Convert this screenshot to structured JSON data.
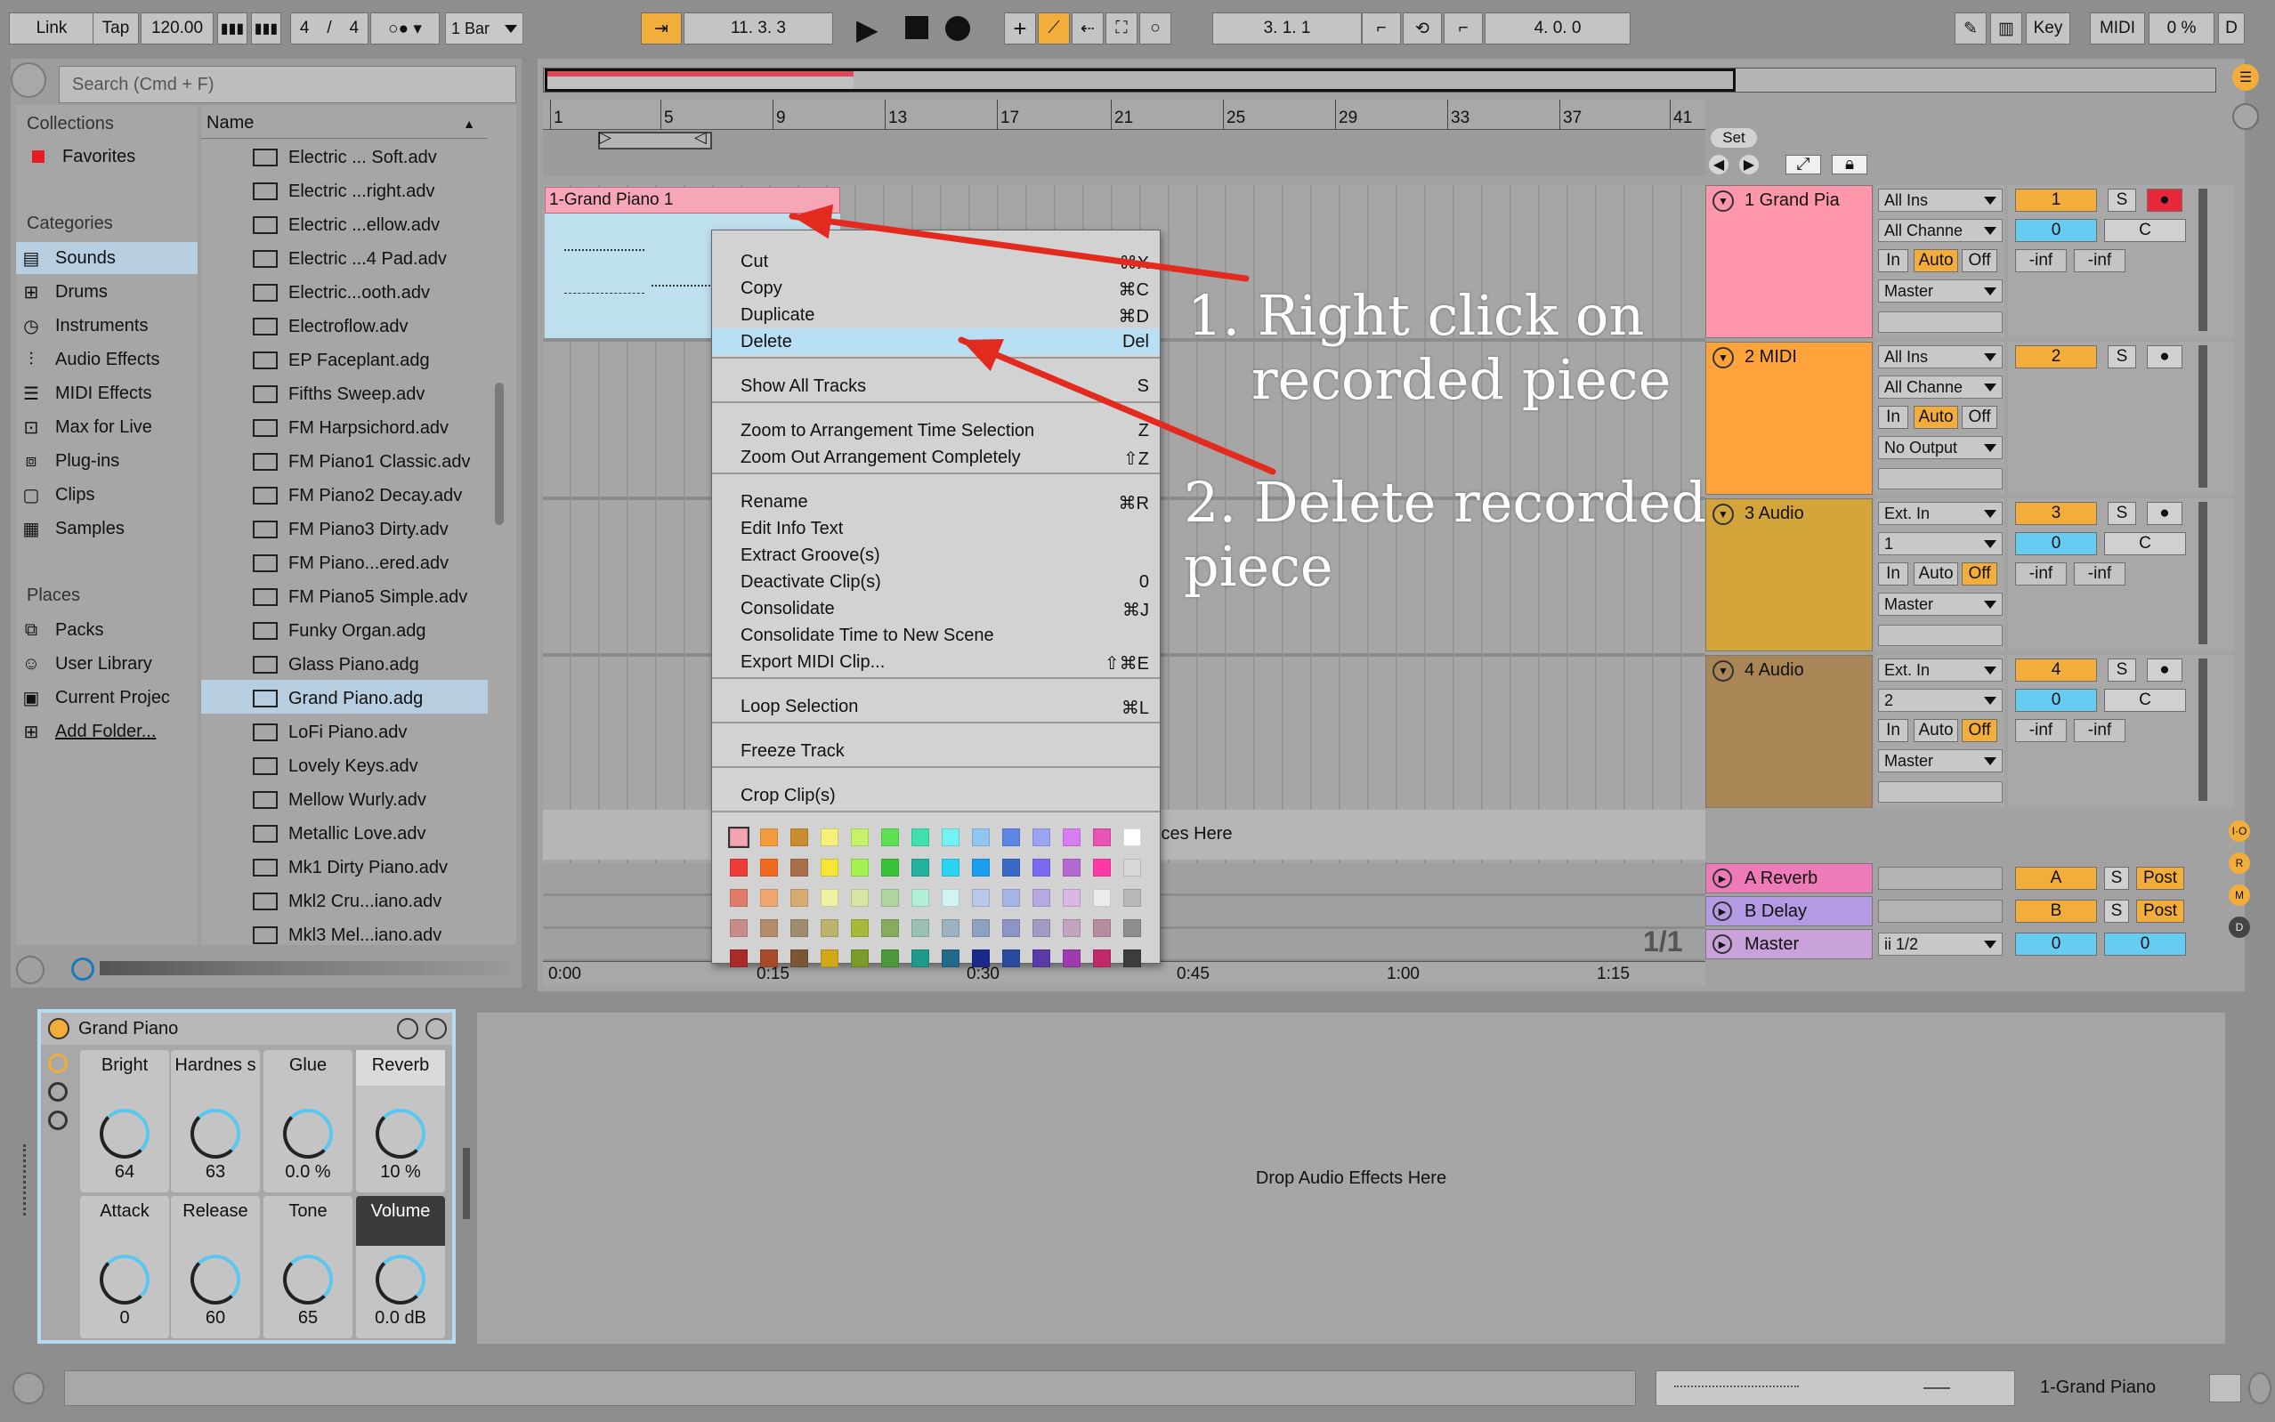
{
  "transport": {
    "link": "Link",
    "tap": "Tap",
    "tempo": "120.00",
    "sig_num": "4",
    "sig_slash": "/",
    "sig_den": "4",
    "quant": "1 Bar",
    "position": "11.  3.  3",
    "loop_start": "3.  1.  1",
    "loop_len": "4.  0.  0",
    "key": "Key",
    "midi": "MIDI",
    "cpu": "0 %",
    "d": "D"
  },
  "browser": {
    "search_placeholder": "Search (Cmd + F)",
    "collections_header": "Collections",
    "favorites": "Favorites",
    "categories_header": "Categories",
    "categories": [
      "Sounds",
      "Drums",
      "Instruments",
      "Audio Effects",
      "MIDI Effects",
      "Max for Live",
      "Plug-ins",
      "Clips",
      "Samples"
    ],
    "places_header": "Places",
    "places": [
      "Packs",
      "User Library",
      "Current Projec",
      "Add Folder..."
    ],
    "name_col": "Name",
    "files": [
      "Electric ... Soft.adv",
      "Electric ...right.adv",
      "Electric ...ellow.adv",
      "Electric ...4 Pad.adv",
      "Electric...ooth.adv",
      "Electroflow.adv",
      "EP Faceplant.adg",
      "Fifths Sweep.adv",
      "FM Harpsichord.adv",
      "FM Piano1 Classic.adv",
      "FM Piano2 Decay.adv",
      "FM Piano3 Dirty.adv",
      "FM Piano...ered.adv",
      "FM Piano5 Simple.adv",
      "Funky Organ.adg",
      "Glass Piano.adg",
      "Grand Piano.adg",
      "LoFi Piano.adv",
      "Lovely Keys.adv",
      "Mellow Wurly.adv",
      "Metallic Love.adv",
      "Mk1 Dirty Piano.adv",
      "Mkl2 Cru...iano.adv",
      "Mkl3 Mel...iano.adv"
    ]
  },
  "arrangement": {
    "ruler_bars": [
      "1",
      "5",
      "9",
      "13",
      "17",
      "21",
      "25",
      "29",
      "33",
      "37",
      "41"
    ],
    "time_marks": [
      "0:00",
      "0:15",
      "0:30",
      "0:45",
      "1:00",
      "1:15"
    ],
    "clip_name": "1-Grand Piano 1",
    "drop_hint": "ices Here",
    "page": "1/1",
    "set_label": "Set"
  },
  "context_menu": {
    "items": [
      {
        "label": "Cut",
        "shortcut": "⌘X"
      },
      {
        "label": "Copy",
        "shortcut": "⌘C"
      },
      {
        "label": "Duplicate",
        "shortcut": "⌘D"
      },
      {
        "label": "Delete",
        "shortcut": "Del"
      },
      {
        "label": "Show All Tracks",
        "shortcut": "S"
      },
      {
        "label": "Zoom to Arrangement Time Selection",
        "shortcut": "Z"
      },
      {
        "label": "Zoom Out Arrangement Completely",
        "shortcut": "⇧Z"
      },
      {
        "label": "Rename",
        "shortcut": "⌘R"
      },
      {
        "label": "Edit Info Text",
        "shortcut": ""
      },
      {
        "label": "Extract Groove(s)",
        "shortcut": ""
      },
      {
        "label": "Deactivate Clip(s)",
        "shortcut": "0"
      },
      {
        "label": "Consolidate",
        "shortcut": "⌘J"
      },
      {
        "label": "Consolidate Time to New Scene",
        "shortcut": ""
      },
      {
        "label": "Export MIDI Clip...",
        "shortcut": "⇧⌘E"
      },
      {
        "label": "Loop Selection",
        "shortcut": "⌘L"
      },
      {
        "label": "Freeze Track",
        "shortcut": ""
      },
      {
        "label": "Crop Clip(s)",
        "shortcut": ""
      }
    ],
    "swatches": [
      [
        "#f4a3b0",
        "#f39a3a",
        "#c98c2e",
        "#f4f07a",
        "#c6f26a",
        "#5de052",
        "#40e0b0",
        "#72f2f2",
        "#90c6f2",
        "#5c86e6",
        "#9aa4f2",
        "#d67ef2",
        "#e853b5",
        "#ffffff"
      ],
      [
        "#ef3a3a",
        "#f26a22",
        "#a8704a",
        "#f5e637",
        "#a4f250",
        "#3ac238",
        "#22b29e",
        "#2ad4f2",
        "#1a9ef0",
        "#3a6ac8",
        "#7a6af2",
        "#b46ad2",
        "#ff3aa8",
        "#d8d8d8"
      ],
      [
        "#e07a6a",
        "#f0a872",
        "#d4ac72",
        "#eef2a2",
        "#d4e6a2",
        "#b0d49e",
        "#b2f0d6",
        "#d2f4f4",
        "#b8c8ea",
        "#a8b4e6",
        "#b8a8e0",
        "#d8b8e2",
        "#ececec",
        "#b8b8b8"
      ],
      [
        "#c88c88",
        "#b48c6a",
        "#9e8c6e",
        "#bcb46e",
        "#a8b83a",
        "#88ac5e",
        "#9cc0b2",
        "#9cb2c0",
        "#8ca2c0",
        "#8c94c8",
        "#a498c4",
        "#c0a4c0",
        "#b88ca0",
        "#8e8e8e"
      ],
      [
        "#aa2a2a",
        "#a84a2a",
        "#7a5636",
        "#d0a81a",
        "#7a9a2a",
        "#4a9a3a",
        "#1c9a8a",
        "#226a8a",
        "#1a2a8a",
        "#2a4aa0",
        "#5a3aa8",
        "#a03ab0",
        "#c02a6a",
        "#3c3c3c"
      ]
    ]
  },
  "annotations": {
    "step1_line1": "1. Right click on",
    "step1_line2": "recorded piece",
    "step2_line1": "2. Delete recorded",
    "step2_line2": "piece",
    "arrow_color": "#e32a1f"
  },
  "tracks": [
    {
      "name": "1 Grand Pia",
      "color": "#ff96aa",
      "input": "All Ins",
      "channel": "All Channe",
      "monitor": [
        "In",
        "Auto",
        "Off"
      ],
      "output": "Master",
      "num": "1",
      "pan": "0",
      "panlbl": "C",
      "vol": "-inf",
      "vol2": "-inf",
      "s": "S"
    },
    {
      "name": "2 MIDI",
      "color": "#ffa33a",
      "input": "All Ins",
      "channel": "All Channe",
      "monitor": [
        "In",
        "Auto",
        "Off"
      ],
      "output": "No Output",
      "num": "2",
      "s": "S"
    },
    {
      "name": "3 Audio",
      "color": "#d4a53a",
      "input": "Ext. In",
      "channel": "1",
      "monitor": [
        "In",
        "Auto",
        "Off"
      ],
      "output": "Master",
      "num": "3",
      "pan": "0",
      "panlbl": "C",
      "vol": "-inf",
      "vol2": "-inf",
      "s": "S"
    },
    {
      "name": "4 Audio",
      "color": "#aa8656",
      "input": "Ext. In",
      "channel": "2",
      "monitor": [
        "In",
        "Auto",
        "Off"
      ],
      "output": "Master",
      "num": "4",
      "pan": "0",
      "panlbl": "C",
      "vol": "-inf",
      "vol2": "-inf",
      "s": "S"
    }
  ],
  "returns": [
    {
      "name": "A Reverb",
      "color": "#ee7ab8",
      "send": "A",
      "s": "S",
      "post": "Post"
    },
    {
      "name": "B Delay",
      "color": "#b39ae2",
      "send": "B",
      "s": "S",
      "post": "Post"
    },
    {
      "name": "Master",
      "color": "#c8a2d8",
      "io": "ii 1/2",
      "vol": "0",
      "vol2": "0"
    }
  ],
  "device": {
    "title": "Grand Piano",
    "params": [
      {
        "name": "Bright",
        "value": "64"
      },
      {
        "name": "Hardnes s",
        "value": "63"
      },
      {
        "name": "Glue",
        "value": "0.0 %"
      },
      {
        "name": "Reverb",
        "value": "10 %"
      },
      {
        "name": "Attack",
        "value": "0"
      },
      {
        "name": "Release",
        "value": "60"
      },
      {
        "name": "Tone",
        "value": "65"
      },
      {
        "name": "Volume",
        "value": "0.0 dB"
      }
    ],
    "drop_effects": "Drop Audio Effects Here"
  },
  "status": {
    "clip_name": "1-Grand Piano"
  },
  "side_buttons": [
    "I·O",
    "R",
    "M",
    "D"
  ]
}
